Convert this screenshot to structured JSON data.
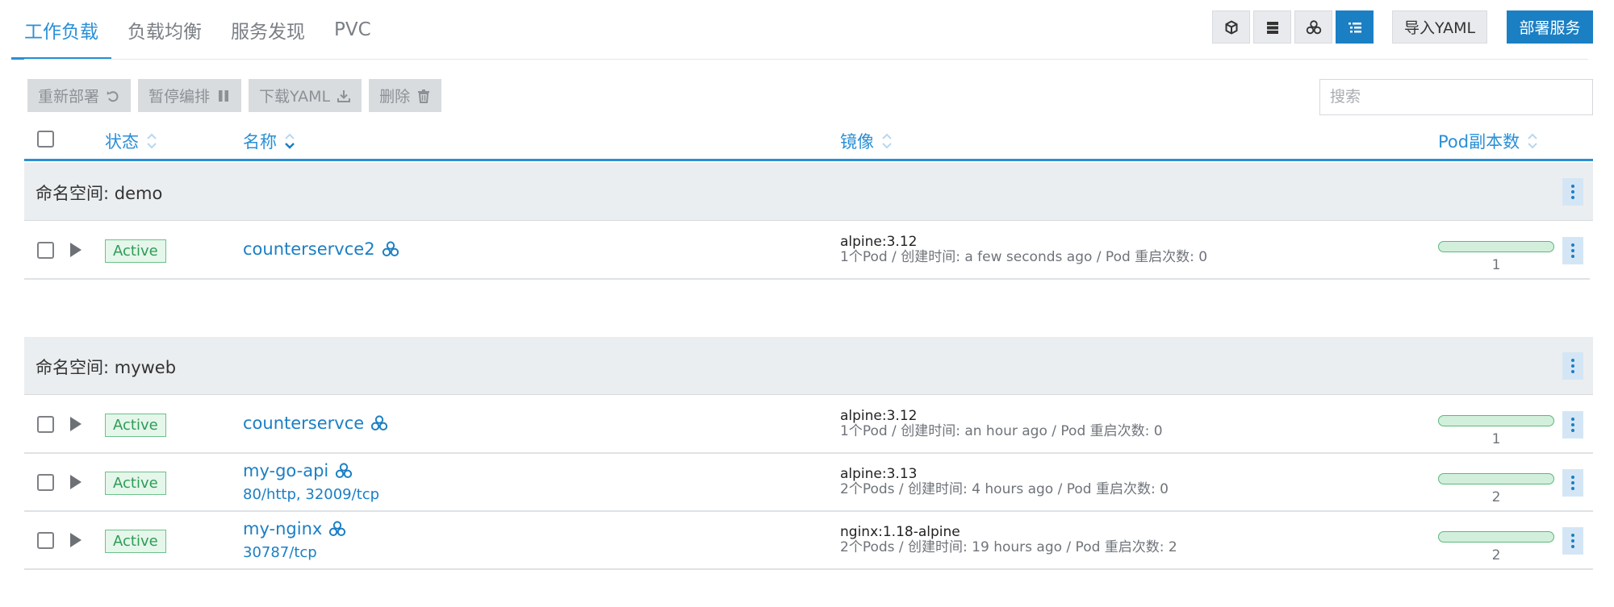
{
  "tabs": [
    {
      "label": "工作负载",
      "active": true
    },
    {
      "label": "负载均衡",
      "active": false
    },
    {
      "label": "服务发现",
      "active": false
    },
    {
      "label": "PVC",
      "active": false
    }
  ],
  "view_toggle": {
    "icons": [
      "cube-icon",
      "server-stack-icon",
      "nodes-icon",
      "list-icon"
    ],
    "active": "list-icon"
  },
  "header_buttons": {
    "import_label": "导入YAML",
    "deploy_label": "部署服务"
  },
  "actions": {
    "redeploy": "重新部署",
    "pause": "暂停编排",
    "download": "下载YAML",
    "delete": "删除"
  },
  "search": {
    "placeholder": "搜索",
    "value": ""
  },
  "columns": {
    "state": "状态",
    "name": "名称",
    "image": "镜像",
    "pods": "Pod副本数"
  },
  "groups": [
    {
      "label": "命名空间: demo",
      "rows": [
        {
          "state": "Active",
          "name": "counterservce2",
          "ports": [],
          "image": "alpine:3.12",
          "meta": "1个Pod / 创建时间: a few seconds ago / Pod 重启次数: 0",
          "pods": "1"
        }
      ]
    },
    {
      "label": "命名空间: myweb",
      "rows": [
        {
          "state": "Active",
          "name": "counterservce",
          "ports": [],
          "image": "alpine:3.12",
          "meta": "1个Pod / 创建时间: an hour ago / Pod 重启次数: 0",
          "pods": "1"
        },
        {
          "state": "Active",
          "name": "my-go-api",
          "ports": [
            "80/http",
            "32009/tcp"
          ],
          "image": "alpine:3.13",
          "meta": "2个Pods / 创建时间: 4 hours ago / Pod 重启次数: 0",
          "pods": "2"
        },
        {
          "state": "Active",
          "name": "my-nginx",
          "ports": [
            "30787/tcp"
          ],
          "image": "nginx:1.18-alpine",
          "meta": "2个Pods / 创建时间: 19 hours ago / Pod 重启次数: 2",
          "pods": "2"
        }
      ]
    }
  ],
  "colors": {
    "accent": "#2a8fd6",
    "primary_button": "#1b7fc4",
    "active_badge": "#2d9c55",
    "progress_fill": "#d2efdc"
  }
}
